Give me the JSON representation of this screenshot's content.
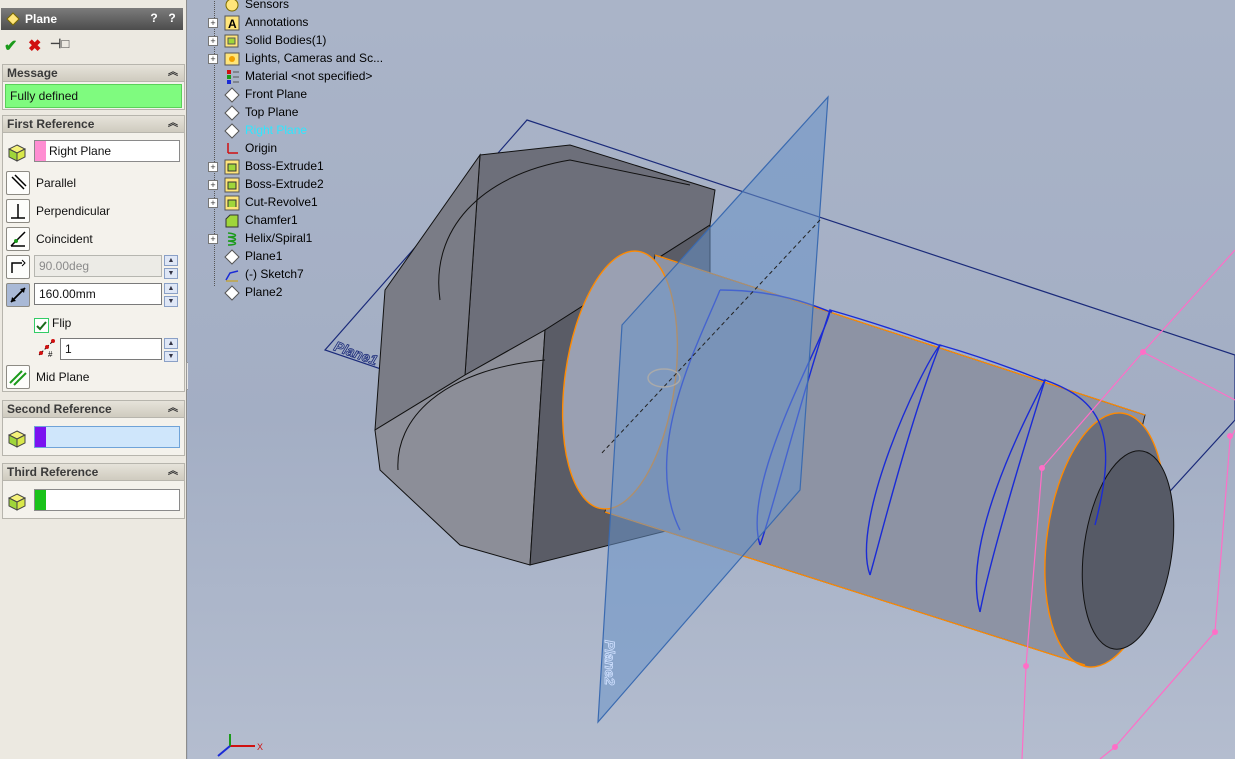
{
  "property_manager": {
    "title": "Plane",
    "help_button": "?",
    "close_glyph": "?",
    "actions": {
      "ok_icon": "checkmark-icon",
      "cancel_icon": "x-icon",
      "pin_icon": "pushpin-icon"
    },
    "message": {
      "header": "Message",
      "text": "Fully defined"
    },
    "first_reference": {
      "header": "First Reference",
      "selection": "Right Plane",
      "options": [
        {
          "label": "Parallel",
          "icon": "parallel-icon"
        },
        {
          "label": "Perpendicular",
          "icon": "perpendicular-icon"
        },
        {
          "label": "Coincident",
          "icon": "coincident-icon"
        }
      ],
      "angle_value": "90.00deg",
      "distance_value": "160.00mm",
      "flip_label": "Flip",
      "flip_checked": true,
      "instances_value": "1",
      "mid_plane_label": "Mid Plane"
    },
    "second_reference": {
      "header": "Second Reference",
      "selection": ""
    },
    "third_reference": {
      "header": "Third Reference",
      "selection": ""
    }
  },
  "feature_tree": [
    {
      "label": "Sensors",
      "expandable": false,
      "icon": "sensor-icon"
    },
    {
      "label": "Annotations",
      "expandable": true,
      "icon": "annotation-icon"
    },
    {
      "label": "Solid Bodies(1)",
      "expandable": true,
      "icon": "solid-bodies-icon"
    },
    {
      "label": "Lights, Cameras and Sc...",
      "expandable": true,
      "icon": "lights-icon"
    },
    {
      "label": "Material <not specified>",
      "expandable": false,
      "icon": "material-icon"
    },
    {
      "label": "Front Plane",
      "expandable": false,
      "icon": "plane-icon"
    },
    {
      "label": "Top Plane",
      "expandable": false,
      "icon": "plane-icon"
    },
    {
      "label": "Right Plane",
      "expandable": false,
      "icon": "plane-icon",
      "selected": true
    },
    {
      "label": "Origin",
      "expandable": false,
      "icon": "origin-icon"
    },
    {
      "label": "Boss-Extrude1",
      "expandable": true,
      "icon": "extrude-icon"
    },
    {
      "label": "Boss-Extrude2",
      "expandable": true,
      "icon": "extrude-icon"
    },
    {
      "label": "Cut-Revolve1",
      "expandable": true,
      "icon": "revolve-icon"
    },
    {
      "label": "Chamfer1",
      "expandable": false,
      "icon": "chamfer-icon"
    },
    {
      "label": "Helix/Spiral1",
      "expandable": true,
      "icon": "helix-icon"
    },
    {
      "label": "Plane1",
      "expandable": false,
      "icon": "plane-icon"
    },
    {
      "label": "(-) Sketch7",
      "expandable": false,
      "icon": "sketch-icon"
    },
    {
      "label": "Plane2",
      "expandable": false,
      "icon": "plane-icon"
    }
  ],
  "viewport": {
    "plane1_label": "Plane1",
    "plane2_label": "Plane2",
    "triad_x_label": "X",
    "colors": {
      "plane": "#6a93c9",
      "helix": "#1a2bd6",
      "edge_highlight": "#ff8a00",
      "sketch": "#ff6ec7"
    }
  }
}
